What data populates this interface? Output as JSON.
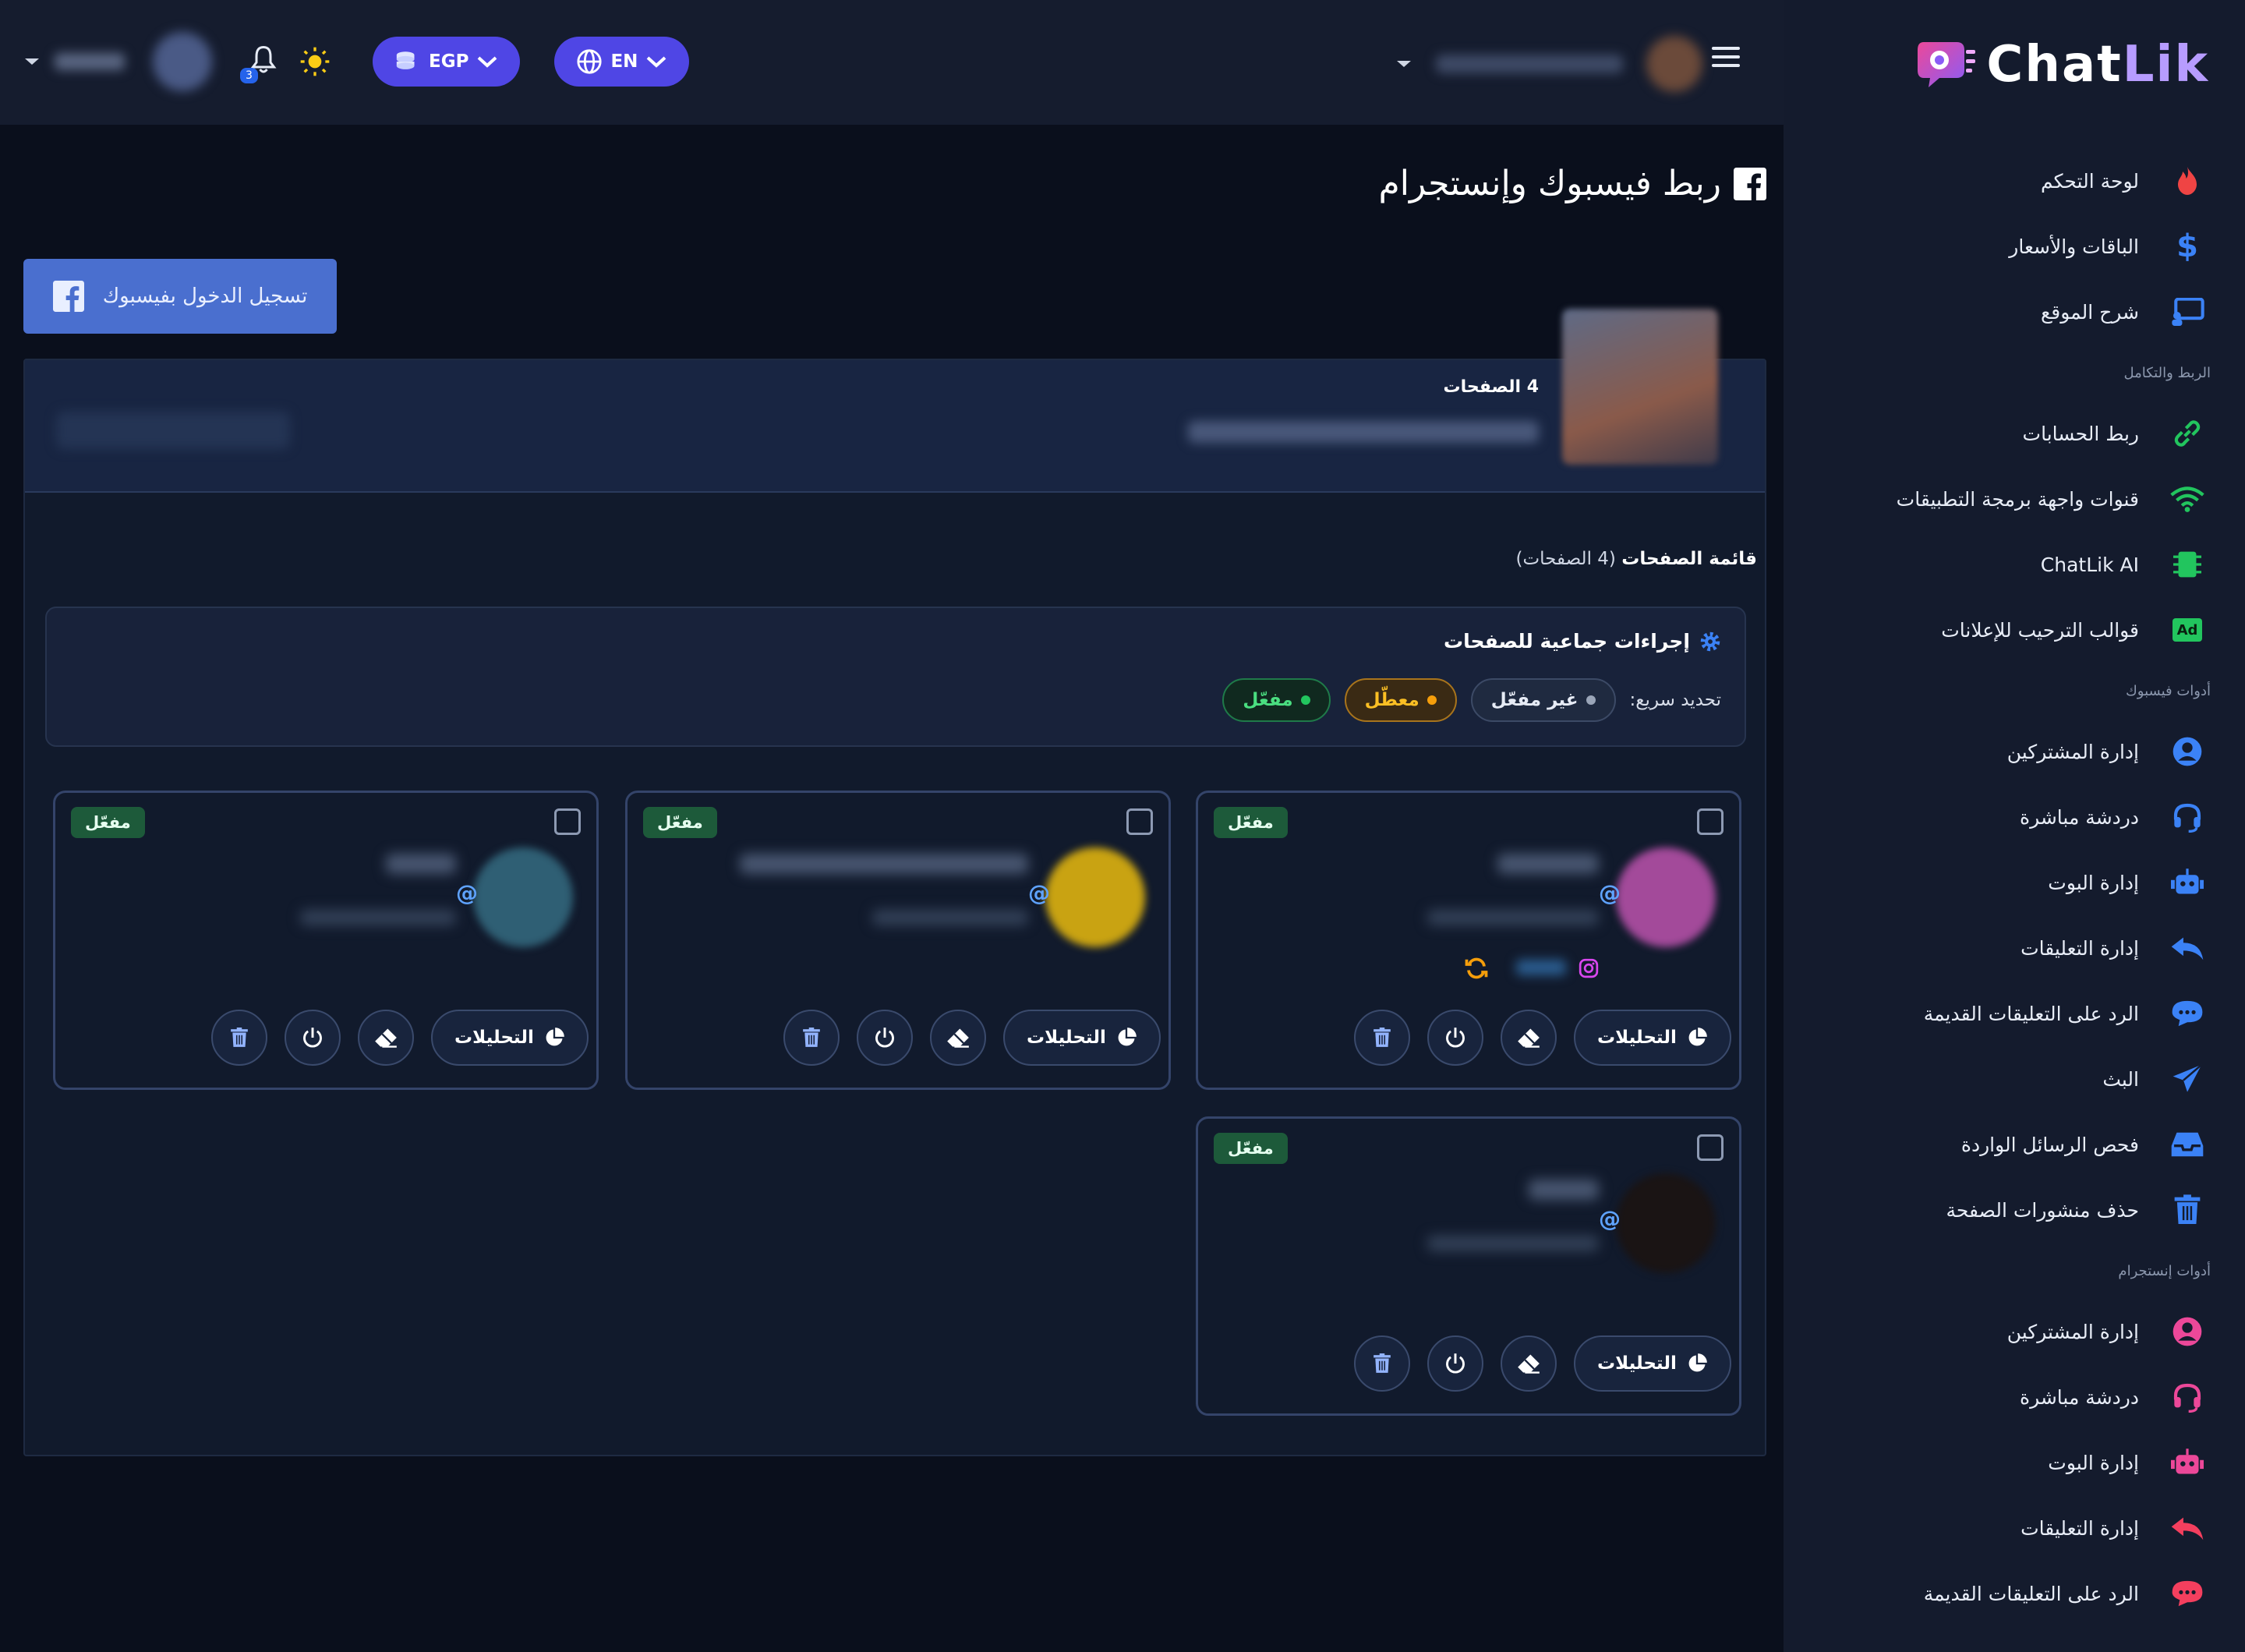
{
  "brand": {
    "name_a": "Chat",
    "name_b": "Lik"
  },
  "header": {
    "currency": "EGP",
    "language": "EN",
    "notification_count": "3"
  },
  "sidebar": {
    "items_top": [
      {
        "label": "لوحة التحكم",
        "icon": "flame-icon"
      },
      {
        "label": "الباقات والأسعار",
        "icon": "dollar-icon"
      },
      {
        "label": "شرح الموقع",
        "icon": "presentation-icon"
      }
    ],
    "section_integration": "الربط والتكامل",
    "items_integration": [
      {
        "label": "ربط الحسابات",
        "icon": "link-icon"
      },
      {
        "label": "قنوات واجهة برمجة التطبيقات",
        "icon": "wifi-icon"
      },
      {
        "label": "ChatLik AI",
        "icon": "chip-icon"
      },
      {
        "label": "قوالب الترحيب للإعلانات",
        "icon": "ad-icon"
      }
    ],
    "section_facebook": "أدوات فيسبوك",
    "items_facebook": [
      {
        "label": "إدارة المشتركين",
        "icon": "user-icon"
      },
      {
        "label": "دردشة مباشرة",
        "icon": "headset-icon"
      },
      {
        "label": "إدارة البوت",
        "icon": "robot-icon"
      },
      {
        "label": "إدارة التعليقات",
        "icon": "reply-icon"
      },
      {
        "label": "الرد على التعليقات القديمة",
        "icon": "comment-icon"
      },
      {
        "label": "البث",
        "icon": "send-icon"
      },
      {
        "label": "فحص الرسائل الواردة",
        "icon": "inbox-icon"
      },
      {
        "label": "حذف منشورات الصفحة",
        "icon": "trash-icon"
      }
    ],
    "section_instagram": "أدوات إنستجرام",
    "items_instagram": [
      {
        "label": "إدارة المشتركين",
        "icon": "user-icon"
      },
      {
        "label": "دردشة مباشرة",
        "icon": "headset-icon"
      },
      {
        "label": "إدارة البوت",
        "icon": "robot-icon"
      },
      {
        "label": "إدارة التعليقات",
        "icon": "reply-icon"
      },
      {
        "label": "الرد على التعليقات القديمة",
        "icon": "comment-icon"
      }
    ]
  },
  "page": {
    "title": "ربط فيسبوك وإنستجرام",
    "fb_login": "تسجيل الدخول بفيسبوك",
    "pages_count_label": "4 الصفحات",
    "list_title_bold": "قائمة الصفحات",
    "list_title_rest": "(4 الصفحات)",
    "bulk_title": "إجراءات جماعية للصفحات",
    "quick_label": "تحديد سريع:",
    "chip_inactive": "غير مفعّل",
    "chip_disabled": "معطّل",
    "chip_enabled": "مفعّل"
  },
  "cards": [
    {
      "status": "مفعّل",
      "analytics": "التحليلات",
      "at": "@"
    },
    {
      "status": "مفعّل",
      "analytics": "التحليلات",
      "at": "@"
    },
    {
      "status": "مفعّل",
      "analytics": "التحليلات",
      "at": "@"
    },
    {
      "status": "مفعّل",
      "analytics": "التحليلات",
      "at": "@"
    }
  ],
  "colors": {
    "accent": "#4f46e5",
    "enabled": "#22c55e",
    "disabled": "#f59e0b",
    "facebook": "#4a6fcf"
  }
}
